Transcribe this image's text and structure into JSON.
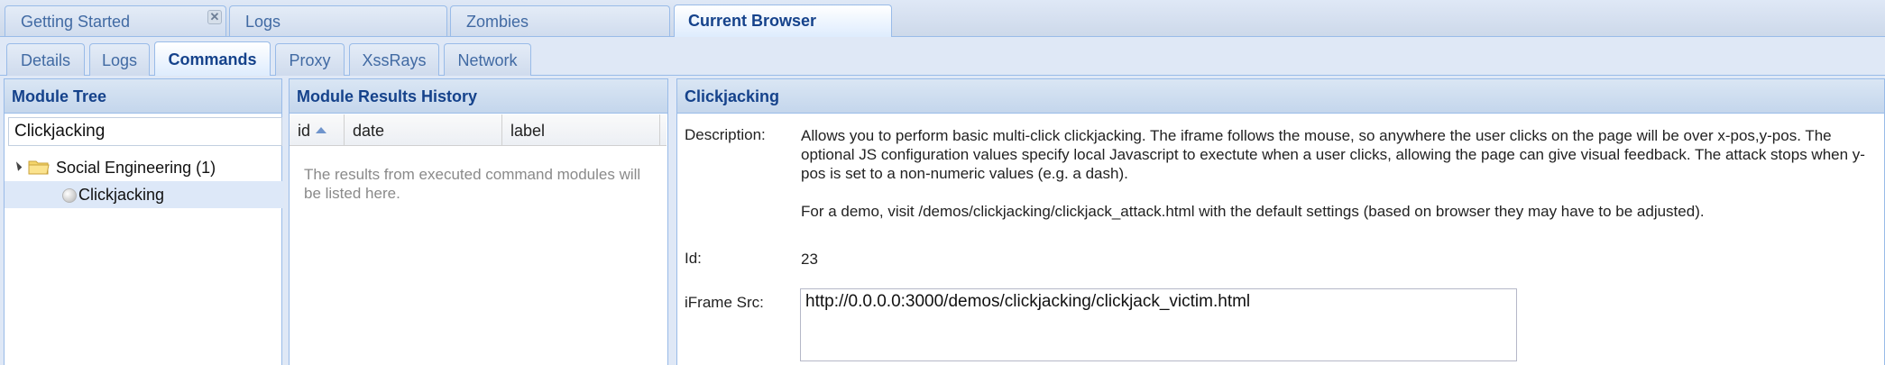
{
  "top_tabs": [
    {
      "label": "Getting Started",
      "closable": true
    },
    {
      "label": "Logs"
    },
    {
      "label": "Zombies"
    },
    {
      "label": "Current Browser",
      "active": true
    }
  ],
  "sub_tabs": [
    {
      "label": "Details"
    },
    {
      "label": "Logs"
    },
    {
      "label": "Commands",
      "active": true
    },
    {
      "label": "Proxy"
    },
    {
      "label": "XssRays"
    },
    {
      "label": "Network"
    }
  ],
  "module_tree": {
    "title": "Module Tree",
    "search_value": "Clickjacking",
    "category": "Social Engineering (1)",
    "module": "Clickjacking"
  },
  "results_history": {
    "title": "Module Results History",
    "columns": [
      "id",
      "date",
      "label"
    ],
    "empty_text": "The results from executed command modules will be listed here."
  },
  "module_detail": {
    "title": "Clickjacking",
    "description_label": "Description:",
    "description_p1": "Allows you to perform basic multi-click clickjacking. The iframe follows the mouse, so anywhere the user clicks on the page will be over x-pos,y-pos. The optional JS configuration values specify local Javascript to exectute when a user clicks, allowing the page can give visual feedback. The attack stops when y-pos is set to a non-numeric values (e.g. a dash).",
    "description_p2": "For a demo, visit /demos/clickjacking/clickjack_attack.html with the default settings (based on browser they may have to be adjusted).",
    "id_label": "Id:",
    "id_value": "23",
    "iframe_label": "iFrame Src:",
    "iframe_value": "http://0.0.0.0:3000/demos/clickjacking/clickjack_victim.html"
  },
  "colors": {
    "header_text": "#15428b",
    "border": "#99bbe8",
    "selected_row": "#dde8f8"
  }
}
